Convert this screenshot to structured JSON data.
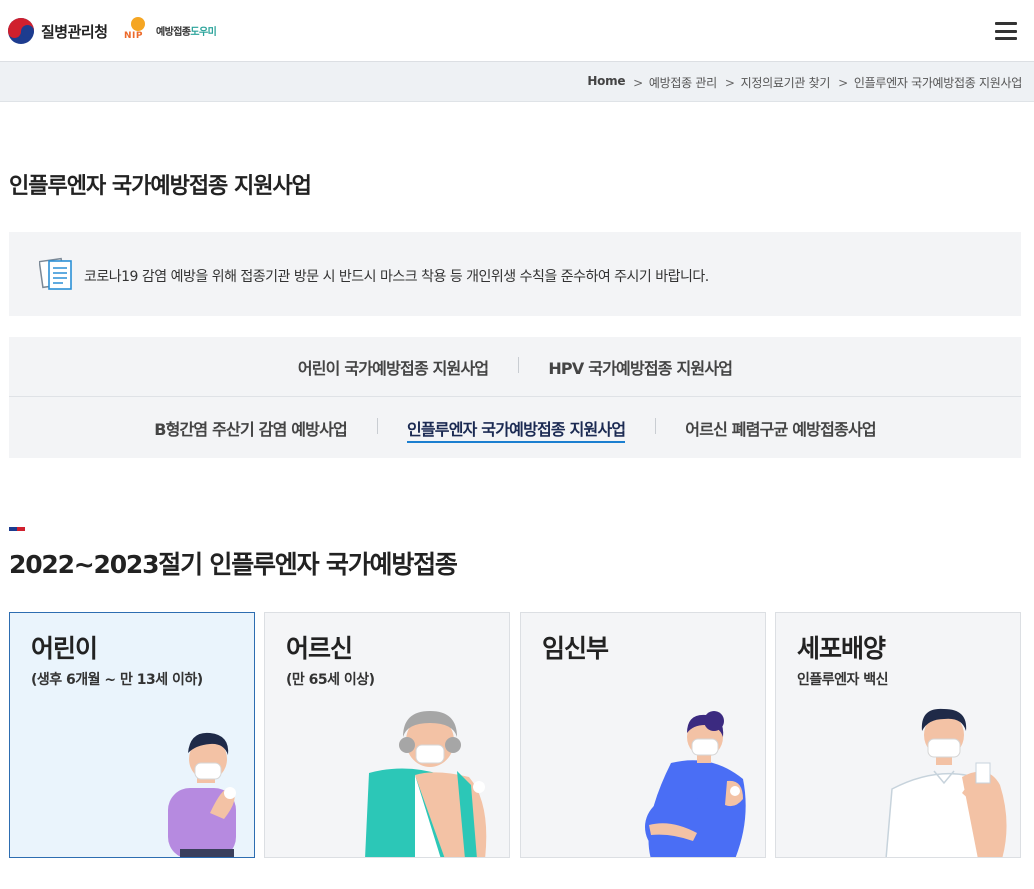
{
  "header": {
    "kdca_logo_text": "질병관리청",
    "nip_logo_letters": "NIP",
    "nip_logo_text_a": "예방접종",
    "nip_logo_text_b": "도우미",
    "menu_icon": "hamburger-menu-icon"
  },
  "breadcrumb": {
    "items": [
      "Home",
      "예방접종 관리",
      "지정의료기관 찾기",
      "인플루엔자 국가예방접종 지원사업"
    ]
  },
  "page_title": "인플루엔자 국가예방접종 지원사업",
  "notice": {
    "icon": "document-icon",
    "text": "코로나19 감염 예방을 위해 접종기관 방문 시 반드시 마스크 착용 등 개인위생 수칙을 준수하여 주시기 바랍니다."
  },
  "tabs": {
    "row1": [
      "어린이 국가예방접종 지원사업",
      "HPV 국가예방접종 지원사업"
    ],
    "row2": [
      "B형간염 주산기 감염 예방사업",
      "인플루엔자 국가예방접종 지원사업",
      "어르신 폐렴구균 예방접종사업"
    ],
    "active": "인플루엔자 국가예방접종 지원사업"
  },
  "section": {
    "title": "2022~2023절기 인플루엔자 국가예방접종"
  },
  "cards": [
    {
      "title": "어린이",
      "subtitle": "(생후 6개월 ~ 만 13세 이하)",
      "illustration": "child-illustration"
    },
    {
      "title": "어르신",
      "subtitle": "(만 65세 이상)",
      "illustration": "elderly-illustration"
    },
    {
      "title": "임신부",
      "subtitle": "",
      "illustration": "pregnant-woman-illustration"
    },
    {
      "title": "세포배양",
      "subtitle": "인플루엔자 백신",
      "illustration": "man-illustration"
    }
  ],
  "colors": {
    "navy": "#1d3c8f",
    "red": "#d0202e",
    "active_border": "#2d6db1",
    "active_underline": "#1b7fd0",
    "card_active_bg": "#eaf4fc"
  }
}
